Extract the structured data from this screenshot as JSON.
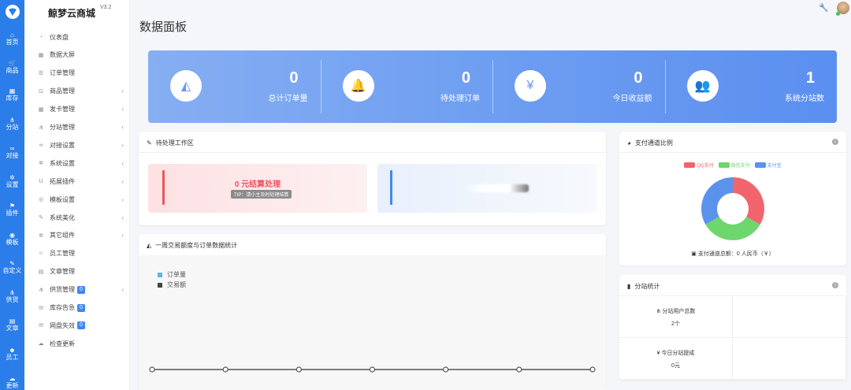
{
  "rail": {
    "items": [
      {
        "icon": "home-icon",
        "glyph": "⌂",
        "label": "首页"
      },
      {
        "icon": "cart-icon",
        "glyph": "🛒",
        "label": "商品"
      },
      {
        "icon": "inventory-icon",
        "glyph": "▦",
        "label": "库存"
      },
      {
        "icon": "sitemap-icon",
        "glyph": "⋔",
        "label": "分站"
      },
      {
        "icon": "link-icon",
        "glyph": "∞",
        "label": "对接"
      },
      {
        "icon": "gear-icon",
        "glyph": "✲",
        "label": "设置"
      },
      {
        "icon": "plugin-icon",
        "glyph": "⚑",
        "label": "插件"
      },
      {
        "icon": "template-icon",
        "glyph": "◉",
        "label": "模板"
      },
      {
        "icon": "pen-icon",
        "glyph": "✎",
        "label": "自定义"
      },
      {
        "icon": "supply-icon",
        "glyph": "⋔",
        "label": "供货"
      },
      {
        "icon": "article-icon",
        "glyph": "▤",
        "label": "文章"
      },
      {
        "icon": "staff-icon",
        "glyph": "☻",
        "label": "员工"
      },
      {
        "icon": "cloud-icon",
        "glyph": "☁",
        "label": "更新"
      }
    ]
  },
  "sidebar": {
    "brand": "鲸梦云商城",
    "version": "V3.2",
    "items": [
      {
        "icon": "dashboard-icon",
        "glyph": "◔",
        "label": "仪表盘",
        "chevron": false,
        "badge": ""
      },
      {
        "icon": "screen-icon",
        "glyph": "▦",
        "label": "数据大屏",
        "chevron": false,
        "badge": ""
      },
      {
        "icon": "order-list-icon",
        "glyph": "☰",
        "label": "订单管理",
        "chevron": false,
        "badge": ""
      },
      {
        "icon": "cart-icon",
        "glyph": "⊡",
        "label": "商品管理",
        "chevron": true,
        "badge": ""
      },
      {
        "icon": "card-icon",
        "glyph": "▦",
        "label": "发卡管理",
        "chevron": true,
        "badge": ""
      },
      {
        "icon": "sitemap-icon",
        "glyph": "⋔",
        "label": "分站管理",
        "chevron": true,
        "badge": ""
      },
      {
        "icon": "link-icon",
        "glyph": "∞",
        "label": "对接设置",
        "chevron": true,
        "badge": ""
      },
      {
        "icon": "gear-icon",
        "glyph": "✲",
        "label": "系统设置",
        "chevron": true,
        "badge": ""
      },
      {
        "icon": "magnet-icon",
        "glyph": "U",
        "label": "拓展插件",
        "chevron": true,
        "badge": ""
      },
      {
        "icon": "template-icon",
        "glyph": "◎",
        "label": "模板设置",
        "chevron": true,
        "badge": ""
      },
      {
        "icon": "brush-icon",
        "glyph": "✎",
        "label": "系统美化",
        "chevron": true,
        "badge": ""
      },
      {
        "icon": "gears-icon",
        "glyph": "✲",
        "label": "其它组件",
        "chevron": true,
        "badge": ""
      },
      {
        "icon": "user-icon",
        "glyph": "☺",
        "label": "员工管理",
        "chevron": false,
        "badge": ""
      },
      {
        "icon": "article-icon",
        "glyph": "▤",
        "label": "文章管理",
        "chevron": false,
        "badge": ""
      },
      {
        "icon": "supply-icon",
        "glyph": "⋔",
        "label": "供货管理",
        "chevron": true,
        "badge": "0"
      },
      {
        "icon": "bullhorn-icon",
        "glyph": "✉",
        "label": "库存告急",
        "chevron": false,
        "badge": "0"
      },
      {
        "icon": "bullhorn-icon",
        "glyph": "✉",
        "label": "网盘失效",
        "chevron": false,
        "badge": "0"
      },
      {
        "icon": "cloud-icon",
        "glyph": "☁",
        "label": "检查更新",
        "chevron": false,
        "badge": ""
      }
    ]
  },
  "header": {
    "title": "数据面板"
  },
  "stats": [
    {
      "icon": "area-chart-icon",
      "glyph": "◭",
      "value": "0",
      "label": "总计订单量"
    },
    {
      "icon": "bell-icon",
      "glyph": "🔔",
      "value": "0",
      "label": "待处理订单"
    },
    {
      "icon": "yen-icon",
      "glyph": "¥",
      "value": "0",
      "label": "今日收益额"
    },
    {
      "icon": "users-icon",
      "glyph": "👥",
      "value": "1",
      "label": "系统分站数"
    }
  ],
  "pending": {
    "title": "待处理工作区",
    "amount": "0 元结算处理",
    "tip": "TIP：请小主及时处理结算"
  },
  "weekly": {
    "title": "一周交易额度与订单数据统计",
    "legend": [
      {
        "label": "订单量",
        "color": "#5fb7d9"
      },
      {
        "label": "交易额",
        "color": "#444444"
      }
    ]
  },
  "chart_data": {
    "type": "line",
    "x": [
      "",
      "",
      "",
      "",
      "",
      "",
      ""
    ],
    "series": [
      {
        "name": "订单量",
        "values": [
          0,
          0,
          0,
          0,
          0,
          0,
          0
        ]
      },
      {
        "name": "交易额",
        "values": [
          0,
          0,
          0,
          0,
          0,
          0,
          0
        ]
      }
    ]
  },
  "payment": {
    "title": "支付通道比例",
    "legend": [
      {
        "label": "QQ支付",
        "color": "#f2646b"
      },
      {
        "label": "微信支付",
        "color": "#6dd66d"
      },
      {
        "label": "支付宝",
        "color": "#5b93ec"
      }
    ],
    "total": "支付通道总额：0 人民币（￥）"
  },
  "substation": {
    "title": "分站统计",
    "cells": [
      {
        "label": "分站用户总数",
        "value": "2个",
        "icon": "sitemap-icon"
      },
      {
        "label": "今日分站提成",
        "value": "0元",
        "icon": "yen-icon"
      }
    ]
  },
  "colors": {
    "rail": "#2b7de9",
    "banner_start": "#86aef2",
    "banner_end": "#5b8ff0",
    "accent": "#3f87f5"
  }
}
